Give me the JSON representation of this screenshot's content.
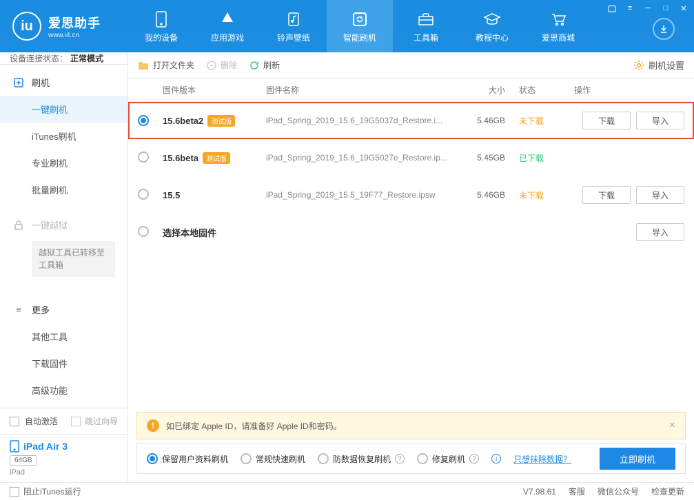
{
  "app": {
    "title": "爱思助手",
    "subtitle": "www.i4.cn"
  },
  "nav": {
    "items": [
      {
        "label": "我的设备"
      },
      {
        "label": "应用游戏"
      },
      {
        "label": "铃声壁纸"
      },
      {
        "label": "智能刷机"
      },
      {
        "label": "工具箱"
      },
      {
        "label": "教程中心"
      },
      {
        "label": "爱思商城"
      }
    ]
  },
  "connection": {
    "label": "设备连接状态：",
    "value": "正常模式"
  },
  "sidebar": {
    "flash": {
      "head": "刷机",
      "items": [
        "一键刷机",
        "iTunes刷机",
        "专业刷机",
        "批量刷机"
      ]
    },
    "jailbreak": {
      "head": "一键越狱",
      "note": "越狱工具已转移至工具箱"
    },
    "more": {
      "head": "更多",
      "items": [
        "其他工具",
        "下载固件",
        "高级功能"
      ]
    },
    "auto_activate": "自动激活",
    "skip_guide": "跳过向导"
  },
  "device": {
    "name": "iPad Air 3",
    "capacity": "64GB",
    "type": "iPad"
  },
  "toolbar": {
    "open_folder": "打开文件夹",
    "delete": "删除",
    "refresh": "刷新",
    "settings": "刷机设置"
  },
  "table": {
    "headers": {
      "version": "固件版本",
      "name": "固件名称",
      "size": "大小",
      "status": "状态",
      "ops": "操作"
    },
    "rows": [
      {
        "version": "15.6beta2",
        "beta": "测试版",
        "name": "iPad_Spring_2019_15.6_19G5037d_Restore.i...",
        "size": "5.46GB",
        "status": "未下载",
        "status_class": "nd",
        "selected": true,
        "download": "下载",
        "import": "导入",
        "highlight": true
      },
      {
        "version": "15.6beta",
        "beta": "测试版",
        "name": "iPad_Spring_2019_15.6_19G5027e_Restore.ip...",
        "size": "5.45GB",
        "status": "已下载",
        "status_class": "dl",
        "selected": false
      },
      {
        "version": "15.5",
        "beta": "",
        "name": "iPad_Spring_2019_15.5_19F77_Restore.ipsw",
        "size": "5.46GB",
        "status": "未下载",
        "status_class": "nd",
        "selected": false,
        "download": "下载",
        "import": "导入"
      },
      {
        "version": "选择本地固件",
        "beta": "",
        "name": "",
        "size": "",
        "status": "",
        "selected": false,
        "import": "导入"
      }
    ]
  },
  "warning": "如已绑定 Apple ID，请准备好 Apple ID和密码。",
  "flash_options": {
    "opts": [
      "保留用户资料刷机",
      "常规快速刷机",
      "防数据恢复刷机",
      "修复刷机"
    ],
    "erase_link": "只想抹除数据？",
    "flash_now": "立即刷机"
  },
  "statusbar": {
    "block_itunes": "阻止iTunes运行",
    "version": "V7.98.61",
    "support": "客服",
    "wechat": "微信公众号",
    "update": "检查更新"
  }
}
